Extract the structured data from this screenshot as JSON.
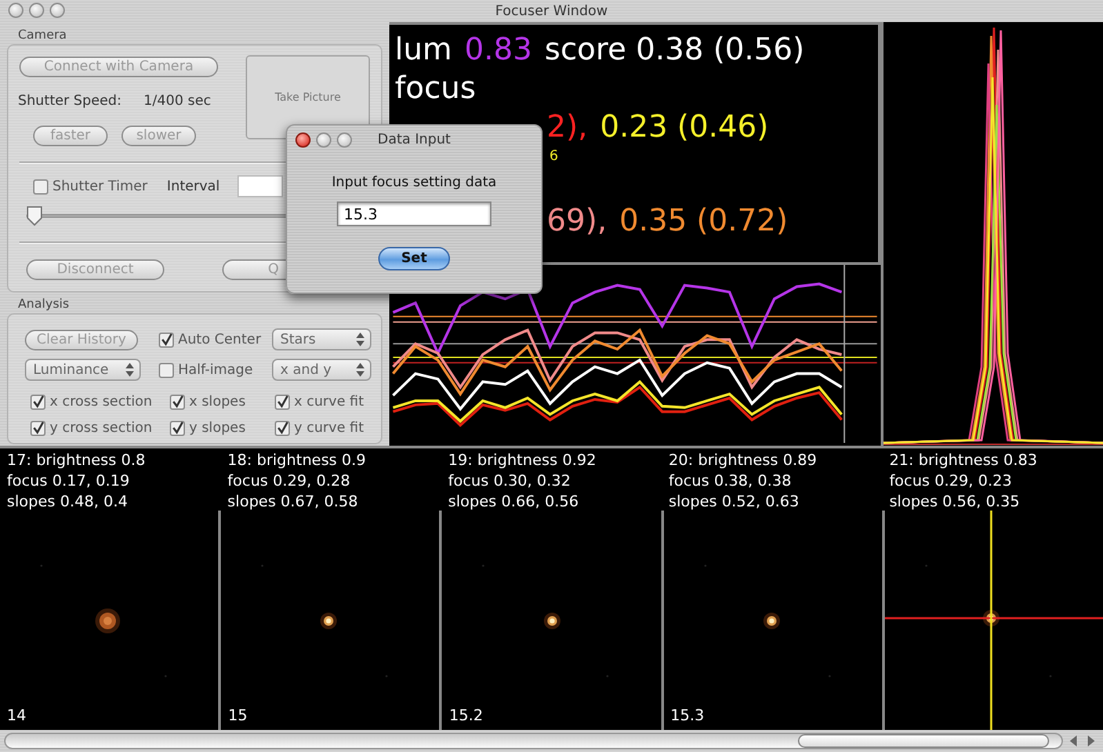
{
  "window": {
    "title": "Focuser Window"
  },
  "camera": {
    "title": "Camera",
    "connect_button": "Connect with Camera",
    "take_picture_button": "Take Picture",
    "shutter_speed_label": "Shutter Speed:",
    "shutter_speed_value": "1/400 sec",
    "faster_button": "faster",
    "slower_button": "slower",
    "shutter_timer": {
      "label": "Shutter Timer",
      "checked": false
    },
    "interval_label": "Interval",
    "interval_slider": {
      "level": 0
    },
    "disconnect_button": "Disconnect",
    "button_6": "Q"
  },
  "analysis": {
    "title": "Analysis",
    "clear_history_button": "Clear History",
    "auto_center": {
      "label": "Auto Center",
      "checked": true
    },
    "target_popup": "Stars",
    "channel_popup": "Luminance",
    "half_image": {
      "label": "Half-image",
      "checked": false
    },
    "axis_popup": "x and y",
    "options": [
      {
        "label": "x cross section",
        "checked": true
      },
      {
        "label": "x slopes",
        "checked": true
      },
      {
        "label": "x curve fit",
        "checked": true
      },
      {
        "label": "y cross section",
        "checked": true
      },
      {
        "label": "y slopes",
        "checked": true
      },
      {
        "label": "y curve fit",
        "checked": true
      }
    ]
  },
  "readout": [
    {
      "kind": "large",
      "segments": [
        {
          "text": "lum",
          "color": "#ffffff"
        },
        {
          "text": "0.83",
          "color": "#b535e8"
        },
        {
          "text": "score 0.38 (0.56)",
          "color": "#ffffff"
        }
      ]
    },
    {
      "kind": "large",
      "segments": [
        {
          "text": "focus",
          "color": "#ffffff"
        }
      ]
    },
    {
      "kind": "large_covered",
      "segments": [
        {
          "text": "2),",
          "color": "#ff2222"
        },
        {
          "text": "0.23 (0.46)",
          "color": "#f5f02a"
        }
      ]
    },
    {
      "kind": "small_covered",
      "segments": [
        {
          "text": "6",
          "color": "#f5f02a"
        }
      ]
    },
    {
      "kind": "large_covered",
      "segments": [
        {
          "text": "69),",
          "color": "#f08a8a"
        },
        {
          "text": "0.35 (0.72)",
          "color": "#f08a30"
        }
      ]
    }
  ],
  "frames": [
    {
      "info": [
        "17: brightness 0.8",
        "focus 0.17, 0.19",
        "slopes 0.48, 0.4"
      ],
      "label": "14",
      "crosshair": false
    },
    {
      "info": [
        "18: brightness 0.9",
        "focus 0.29, 0.28",
        "slopes 0.67, 0.58"
      ],
      "label": "15",
      "crosshair": false
    },
    {
      "info": [
        "19: brightness 0.92",
        "focus 0.30, 0.32",
        "slopes 0.66, 0.56"
      ],
      "label": "15.2",
      "crosshair": false
    },
    {
      "info": [
        "20: brightness 0.89",
        "focus 0.38, 0.38",
        "slopes 0.52, 0.63"
      ],
      "label": "15.3",
      "crosshair": false
    },
    {
      "info": [
        "21: brightness 0.83",
        "focus 0.29, 0.23",
        "slopes 0.56, 0.35"
      ],
      "crosshair": true
    }
  ],
  "dialog": {
    "title": "Data Input",
    "prompt": "Input focus setting data",
    "value": "15.3",
    "set_button": "Set"
  }
}
